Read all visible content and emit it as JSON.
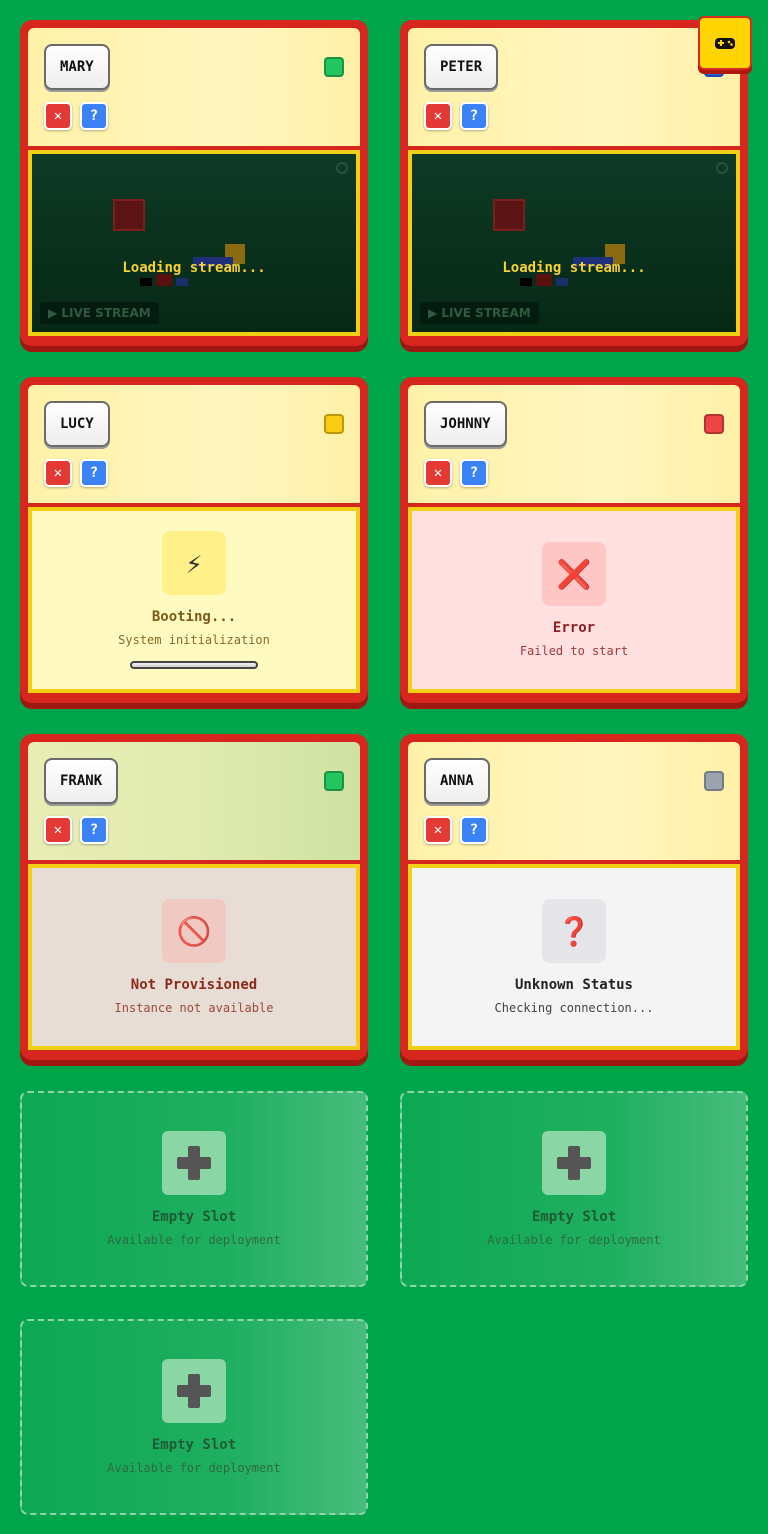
{
  "colors": {
    "background": "#00a44a",
    "card_frame": "#d7261e",
    "status_green": "#22c55e",
    "status_yellow": "#facc15",
    "status_red": "#ef4444",
    "status_gray": "#9ca3af",
    "status_blue": "#2563eb"
  },
  "toolbar": {
    "gamepad_icon": "gamepad-icon"
  },
  "common": {
    "close_label": "✕",
    "help_label": "?",
    "loading_text": "Loading stream...",
    "live_badge": "▶ LIVE STREAM"
  },
  "instances": [
    {
      "name": "MARY",
      "status_color": "#22c55e",
      "state": "streaming"
    },
    {
      "name": "PETER",
      "status_color": "#2563eb",
      "state": "streaming"
    },
    {
      "name": "LUCY",
      "status_color": "#facc15",
      "state": "booting",
      "title": "Booting...",
      "subtitle": "System initialization",
      "icon": "⚡",
      "progress": 0
    },
    {
      "name": "JOHNNY",
      "status_color": "#ef4444",
      "state": "error",
      "title": "Error",
      "subtitle": "Failed to start",
      "icon": "❌"
    },
    {
      "name": "FRANK",
      "status_color": "#22c55e",
      "state": "not-provisioned",
      "title": "Not Provisioned",
      "subtitle": "Instance not available",
      "icon": "🚫"
    },
    {
      "name": "ANNA",
      "status_color": "#9ca3af",
      "state": "unknown",
      "title": "Unknown Status",
      "subtitle": "Checking connection...",
      "icon": "❓"
    }
  ],
  "empty_slots": [
    {
      "title": "Empty Slot",
      "subtitle": "Available for deployment"
    },
    {
      "title": "Empty Slot",
      "subtitle": "Available for deployment"
    },
    {
      "title": "Empty Slot",
      "subtitle": "Available for deployment"
    }
  ]
}
